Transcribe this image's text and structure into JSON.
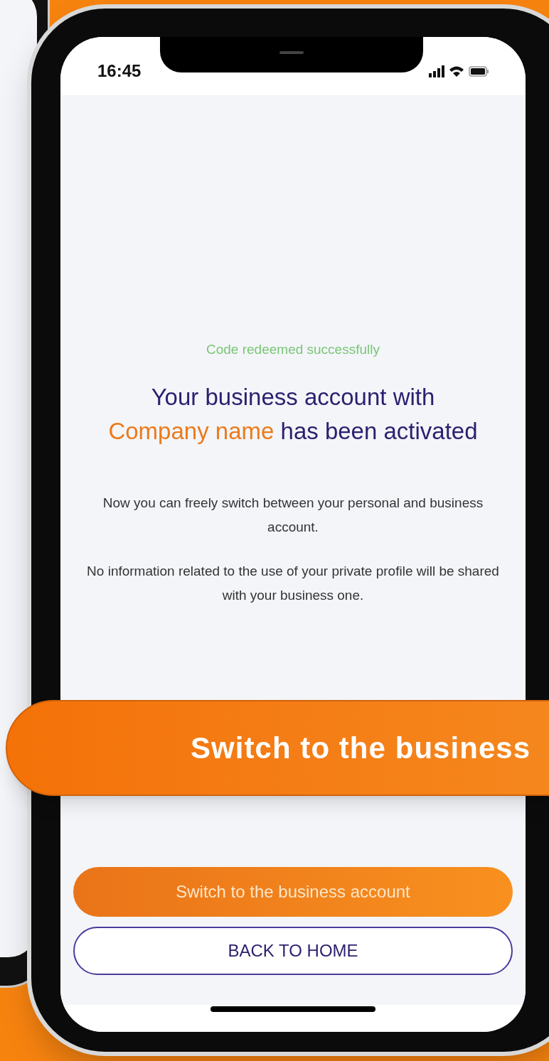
{
  "status_bar": {
    "time": "16:45"
  },
  "success_message": "Code redeemed successfully",
  "heading": {
    "before": "Your business account with",
    "highlight": "Company name",
    "after": "has been activated"
  },
  "paragraphs": [
    "Now you can freely switch between your personal and business account.",
    "No information related to the use of your private profile will be shared with your business one."
  ],
  "buttons": [
    {
      "kind": "primary",
      "label": "Switch to the business account"
    },
    {
      "kind": "outline",
      "label": "BACK TO HOME"
    }
  ],
  "callout": {
    "label": "Switch to the business"
  }
}
